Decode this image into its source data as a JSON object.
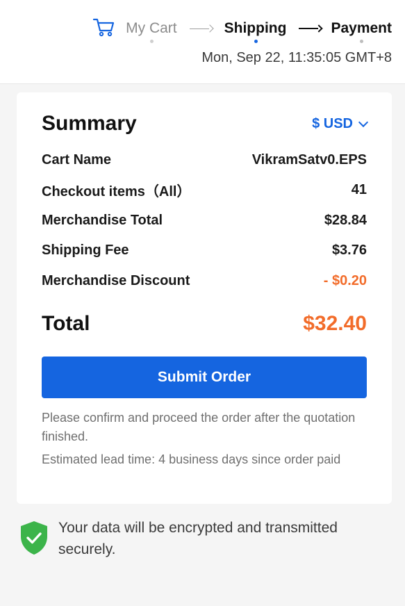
{
  "header": {
    "steps": [
      {
        "label": "My Cart",
        "state": "done"
      },
      {
        "label": "Shipping",
        "state": "current"
      },
      {
        "label": "Payment",
        "state": "upcoming"
      }
    ],
    "timestamp": "Mon, Sep 22, 11:35:05 GMT+8"
  },
  "summary": {
    "title": "Summary",
    "currency": "$ USD",
    "rows": [
      {
        "label": "Cart Name",
        "value": "VikramSatv0.EPS"
      },
      {
        "label": "Checkout items（All）",
        "value": "41"
      },
      {
        "label": "Merchandise Total",
        "value": "$28.84"
      },
      {
        "label": "Shipping Fee",
        "value": "$3.76"
      },
      {
        "label": "Merchandise Discount",
        "value": "- $0.20"
      }
    ],
    "total_label": "Total",
    "total_value": "$32.40",
    "submit_label": "Submit Order",
    "note_confirm": "Please confirm and proceed the order after the quotation finished.",
    "note_lead_time": "Estimated lead time: 4 business days since order paid"
  },
  "security": {
    "message": "Your data will be encrypted and transmitted securely."
  },
  "colors": {
    "accent_blue": "#1565e0",
    "price_orange": "#f26c2a",
    "shield_green": "#3cb44a"
  }
}
